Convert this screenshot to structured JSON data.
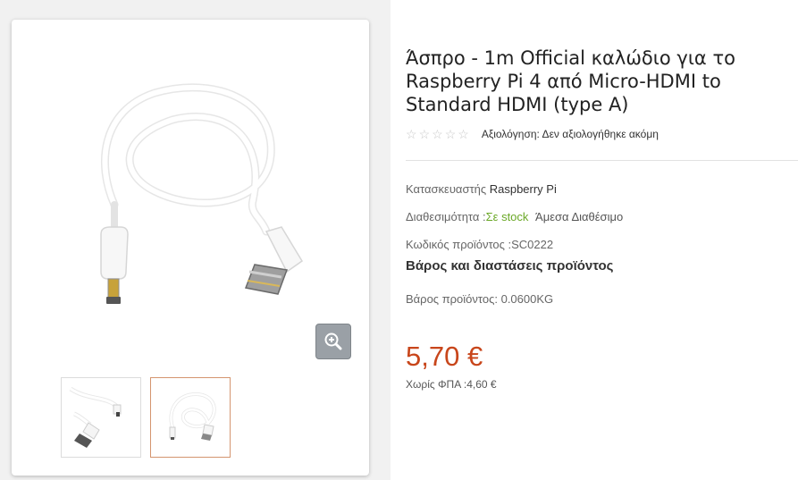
{
  "product": {
    "title": "Άσπρο - 1m Official καλώδιο για το Raspberry Pi 4 από Micro-HDMI to Standard HDMI (type A)",
    "rating": {
      "stars_total": 5,
      "stars_filled": 0,
      "label": "Αξιολόγηση: Δεν αξιολογήθηκε ακόμη"
    },
    "manufacturer_label": "Κατασκευαστής",
    "manufacturer_value": "Raspberry Pi",
    "availability_label": "Διαθεσιμότητα :",
    "availability_value": "Σε stock",
    "availability_extra": "Άμεσα Διαθέσιμο",
    "code_label": "Κωδικός προϊόντος :",
    "code_value": "SC0222",
    "specs_heading": "Βάρος και διαστάσεις προϊόντος",
    "weight_label": "Βάρος προϊόντος:",
    "weight_value": "0.0600KG",
    "price": "5,70 €",
    "net_label": "Χωρίς ΦΠΑ :",
    "net_value": "4,60 €"
  },
  "gallery": {
    "zoom_icon": "zoom-in-icon",
    "thumbnails": [
      "cable-thumbnail-1",
      "cable-thumbnail-2"
    ],
    "active_thumbnail": 1
  },
  "colors": {
    "price": "#c8461b",
    "in_stock": "#6aa826",
    "active_thumb_border": "#d4956f",
    "zoom_button": "#9aa0a6"
  }
}
